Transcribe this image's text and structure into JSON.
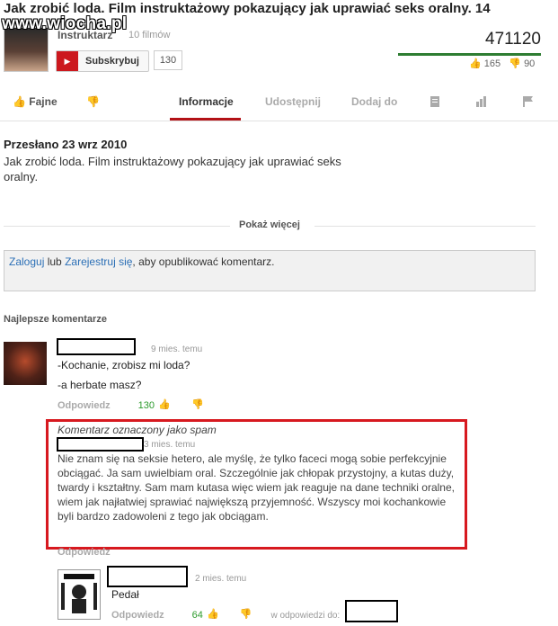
{
  "video": {
    "title": "Jak zrobić loda. Film instruktażowy pokazujący jak uprawiać seks oralny. 14",
    "watermark": "www.wiocha.pl",
    "channel": "Instruktarz",
    "videos_count": "10 filmów",
    "subscribe_label": "Subskrybuj",
    "subscriber_count": "130",
    "views": "471120",
    "like_count": "165",
    "dislike_count": "90"
  },
  "actions": {
    "like_label": "Fajne",
    "tabs": [
      "Informacje",
      "Udostępnij",
      "Dodaj do"
    ]
  },
  "description": {
    "date": "Przesłano 23 wrz 2010",
    "text": "Jak zrobić loda. Film instruktażowy pokazujący jak uprawiać seks oralny.",
    "show_more": "Pokaż więcej"
  },
  "login_prompt": {
    "login": "Zaloguj",
    "or": "lub",
    "register": "Zarejestruj się",
    "rest": ", aby opublikować komentarz."
  },
  "comments": {
    "heading": "Najlepsze komentarze",
    "c1": {
      "time": "9 mies. temu",
      "line1": "-Kochanie, zrobisz mi loda?",
      "line2": "-a herbate masz?",
      "reply": "Odpowiedz",
      "likes": "130"
    },
    "spam": {
      "label": "Komentarz oznaczony jako spam",
      "time": "3 mies. temu",
      "text": "Nie znam się na seksie hetero, ale myślę, że tylko faceci mogą sobie perfekcyjnie obciągać. Ja sam uwielbiam oral. Szczególnie jak chłopak przystojny, a kutas duży, twardy i kształtny. Sam mam kutasa więc wiem jak reaguje na dane techniki oralne, wiem jak najłatwiej sprawiać największą przyjemność. Wszyscy moi kochankowie byli bardzo zadowoleni z tego jak obciągam.",
      "reply": "Odpowiedz"
    },
    "c3": {
      "time": "2 mies. temu",
      "text": "Pedał",
      "reply": "Odpowiedz",
      "likes": "64",
      "in_reply": "w odpowiedzi do:"
    }
  },
  "colors": {
    "accent_red": "#b31217",
    "like_green": "#2d9b2d",
    "spam_frame": "#d7191f",
    "link_blue": "#2b6fb6"
  }
}
